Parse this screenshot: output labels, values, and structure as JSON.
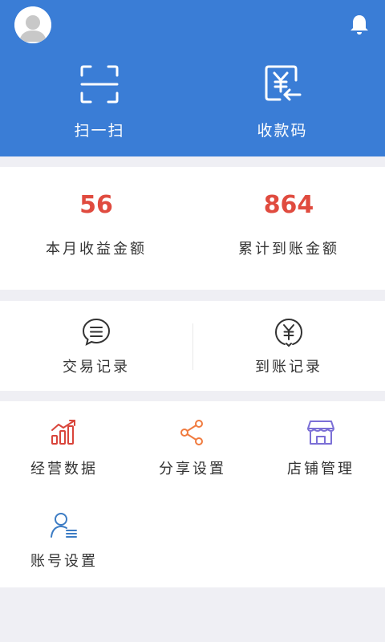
{
  "header": {
    "scan_label": "扫一扫",
    "receipt_code_label": "收款码"
  },
  "stats": {
    "monthly_income_value": "56",
    "monthly_income_label": "本月收益金额",
    "total_received_value": "864",
    "total_received_label": "累计到账金额"
  },
  "records": {
    "transactions_label": "交易记录",
    "received_label": "到账记录"
  },
  "menu": [
    {
      "label": "经营数据",
      "icon": "bar-chart-icon"
    },
    {
      "label": "分享设置",
      "icon": "share-icon"
    },
    {
      "label": "店铺管理",
      "icon": "shop-icon"
    },
    {
      "label": "账号设置",
      "icon": "account-icon"
    }
  ],
  "colors": {
    "brand_blue": "#3a7dd6",
    "stat_red": "#e04b3f",
    "icon_red": "#d9453b",
    "icon_orange": "#f07b3f",
    "icon_purple": "#7b6fd6",
    "icon_blue": "#3c7cc4"
  }
}
